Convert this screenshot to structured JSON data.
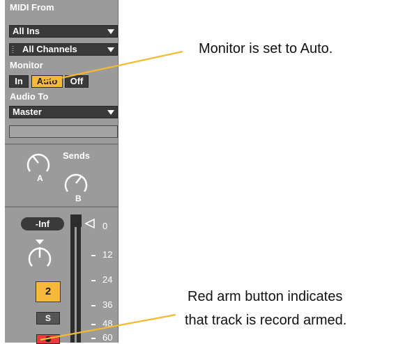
{
  "midi_from": {
    "label": "MIDI From",
    "input_value": "All Ins",
    "channel_value": "All Channels"
  },
  "monitor": {
    "label": "Monitor",
    "options": [
      "In",
      "Auto",
      "Off"
    ],
    "selected": "Auto"
  },
  "audio_to": {
    "label": "Audio To",
    "value": "Master"
  },
  "sends": {
    "label": "Sends",
    "knobs": [
      "A",
      "B"
    ]
  },
  "mixer": {
    "volume_readout": "-Inf",
    "meter_ticks": [
      "0",
      "12",
      "24",
      "36",
      "48",
      "60"
    ],
    "track_number": "2",
    "solo_label": "S"
  },
  "annotations": {
    "monitor_note": "Monitor is set to Auto.",
    "arm_note_line1": "Red arm button indicates",
    "arm_note_line2": "that track is record armed."
  },
  "colors": {
    "panel": "#9b9b9b",
    "control_dark": "#3a3a3a",
    "active_orange": "#f7b83c",
    "arm_red": "#e83b3b",
    "callout_line": "#f5b82e"
  }
}
